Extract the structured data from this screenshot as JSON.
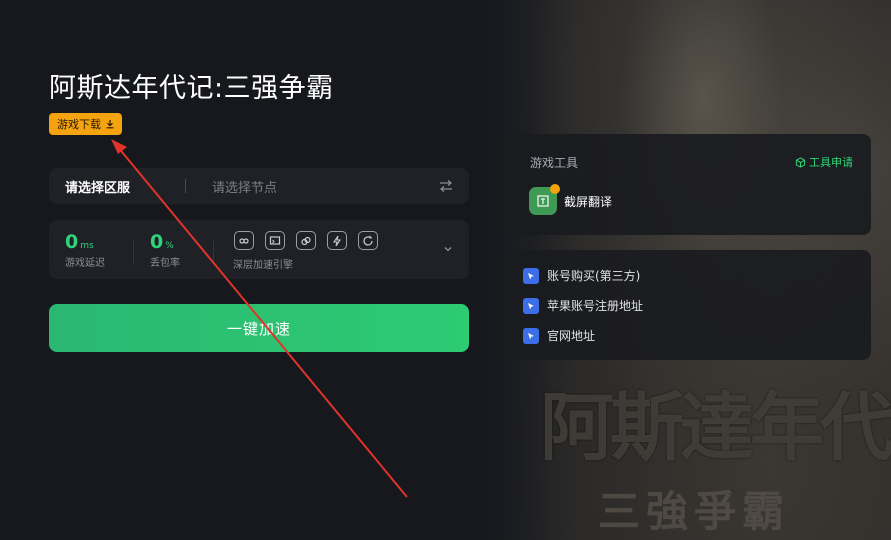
{
  "game": {
    "title": "阿斯达年代记:三强争霸",
    "download_label": "游戏下载"
  },
  "region": {
    "select_label": "请选择区服",
    "node_placeholder": "请选择节点"
  },
  "stats": {
    "latency_value": "0",
    "latency_unit": "ms",
    "latency_label": "游戏延迟",
    "loss_value": "0",
    "loss_unit": "%",
    "loss_label": "丢包率",
    "engine_label": "深层加速引擎",
    "engine_icons": [
      "loop-icon",
      "screen-icon",
      "link-icon",
      "bolt-icon",
      "refresh-icon"
    ]
  },
  "accelerate": {
    "label": "一键加速"
  },
  "tools": {
    "title": "游戏工具",
    "apply_label": "工具申请",
    "items": [
      {
        "label": "截屏翻译",
        "icon": "screenshot-translate-icon"
      }
    ]
  },
  "links": {
    "items": [
      {
        "label": "账号购买(第三方)",
        "icon": "link-cursor-icon"
      },
      {
        "label": "苹果账号注册地址",
        "icon": "link-cursor-icon"
      },
      {
        "label": "官网地址",
        "icon": "link-cursor-icon"
      }
    ]
  },
  "background": {
    "art_title": "阿斯達年代記",
    "art_subtitle": "三強爭霸"
  },
  "colors": {
    "accent_green": "#2fd47a",
    "button_green": "#2ccc73",
    "download_orange": "#f5a30f",
    "annotation_red": "#e0332a"
  }
}
